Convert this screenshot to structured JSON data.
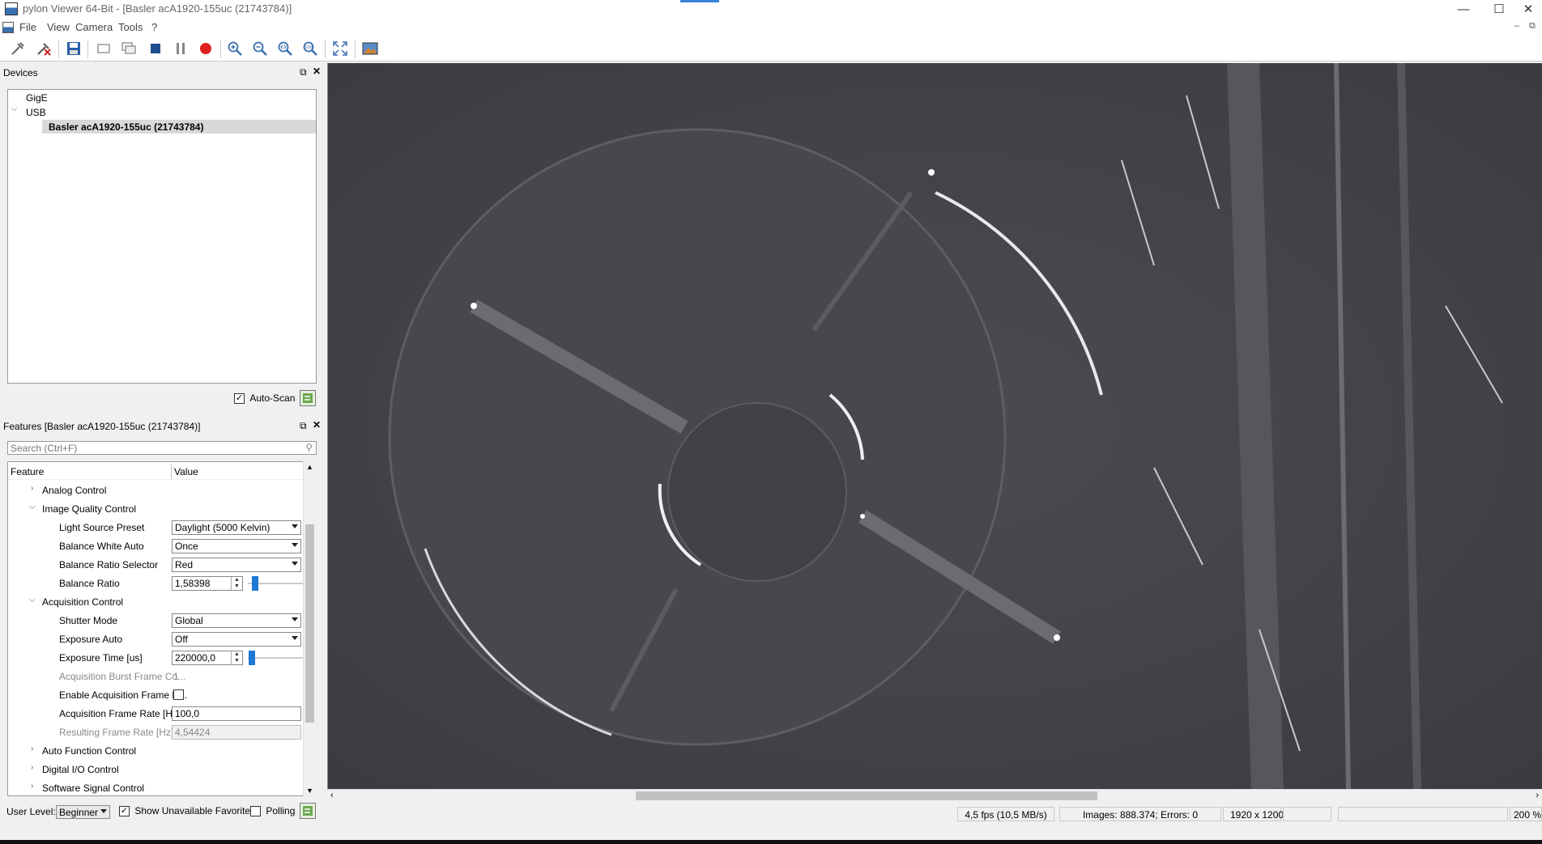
{
  "window": {
    "title": "pylon Viewer 64-Bit - [Basler acA1920-155uc (21743784)]",
    "min": "—",
    "max": "☐",
    "close": "✕"
  },
  "menu": [
    "File",
    "View",
    "Camera",
    "Tools",
    "?"
  ],
  "toolbar": [
    "open-camera",
    "close-camera",
    "save-image",
    "single-shot",
    "continuous-shot",
    "stop",
    "pause",
    "record",
    "zoom-in",
    "zoom-out",
    "zoom-fit",
    "zoom-100",
    "fullscreen",
    "image-view"
  ],
  "devices": {
    "title": "Devices",
    "tree": {
      "gige": "GigE",
      "usb": "USB",
      "device": "Basler acA1920-155uc (21743784)"
    },
    "auto_scan_label": "Auto-Scan",
    "auto_scan_checked": true
  },
  "features": {
    "title": "Features [Basler acA1920-155uc (21743784)]",
    "search_placeholder": "Search (Ctrl+F)",
    "col_feature": "Feature",
    "col_value": "Value",
    "analog_control": "Analog Control",
    "image_quality_control": "Image Quality Control",
    "light_source_preset": {
      "label": "Light Source Preset",
      "value": "Daylight (5000 Kelvin)"
    },
    "balance_white_auto": {
      "label": "Balance White Auto",
      "value": "Once"
    },
    "balance_ratio_selector": {
      "label": "Balance Ratio Selector",
      "value": "Red"
    },
    "balance_ratio": {
      "label": "Balance Ratio",
      "value": "1,58398"
    },
    "acquisition_control": "Acquisition Control",
    "shutter_mode": {
      "label": "Shutter Mode",
      "value": "Global"
    },
    "exposure_auto": {
      "label": "Exposure Auto",
      "value": "Off"
    },
    "exposure_time": {
      "label": "Exposure Time [us]",
      "value": "220000,0"
    },
    "burst_frame_count": {
      "label": "Acquisition Burst Frame Co...",
      "value": "1"
    },
    "enable_frame_rate": {
      "label": "Enable Acquisition Frame R..."
    },
    "frame_rate": {
      "label": "Acquisition Frame Rate [Hz]",
      "value": "100,0"
    },
    "resulting_frame_rate": {
      "label": "Resulting Frame Rate [Hz]",
      "value": "4,54424"
    },
    "auto_function_control": "Auto Function Control",
    "digital_io_control": "Digital I/O Control",
    "software_signal_control": "Software Signal Control"
  },
  "bottom": {
    "user_level_label": "User Level:",
    "user_level_value": "Beginner",
    "show_unavailable": "Show Unavailable Favorites",
    "polling": "Polling"
  },
  "status": {
    "fps": "4,5 fps (10,5 MB/s)",
    "images": "Images: 888.374; Errors: 0",
    "resolution": "1920 x 1200",
    "zoom": "200 %"
  },
  "colors": {
    "accent": "#1e7ad6",
    "record": "#e02020",
    "stop": "#1f4e8c"
  }
}
